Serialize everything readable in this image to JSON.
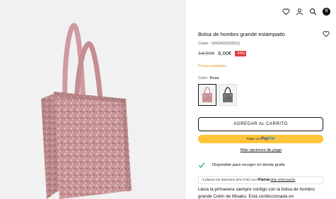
{
  "header": {
    "cart_count": "0",
    "icons": [
      "heart-icon",
      "user-icon",
      "search-icon",
      "cart-icon"
    ]
  },
  "product": {
    "title": "Bolsa de hombro grande estampado",
    "reference": "Cokin - 5000426182011",
    "old_price": "14,99€",
    "price": "6,00€",
    "discount": "-60%",
    "stock_status": "Pocas unidades",
    "color_label": "Color:",
    "color_value": "Rosa",
    "colors": {
      "bag_pink": "#c99497",
      "strap_pink": "#cf9aa0",
      "stock_orange": "#e8932e",
      "discount_red": "#e23b3b",
      "paypal_yellow": "#ffc43a"
    }
  },
  "actions": {
    "add_to_cart": "AGREGAR AL CARRITO",
    "paypal_prefix": "Pagar con",
    "paypal_brand_a": "Pay",
    "paypal_brand_b": "Pal",
    "more_payment": "Más opciones de pago"
  },
  "pickup": {
    "text": "Disponible para recoger en tienda gratis"
  },
  "klarna": {
    "text": "3 plazos sin intereses (0% TAE) con",
    "brand": "Klarna",
    "link": "Más información"
  },
  "description": {
    "text": "Lleva la primavera siempre contigo con la bolsa de hombro grande Cokin de Misako. Está confeccionada en"
  }
}
